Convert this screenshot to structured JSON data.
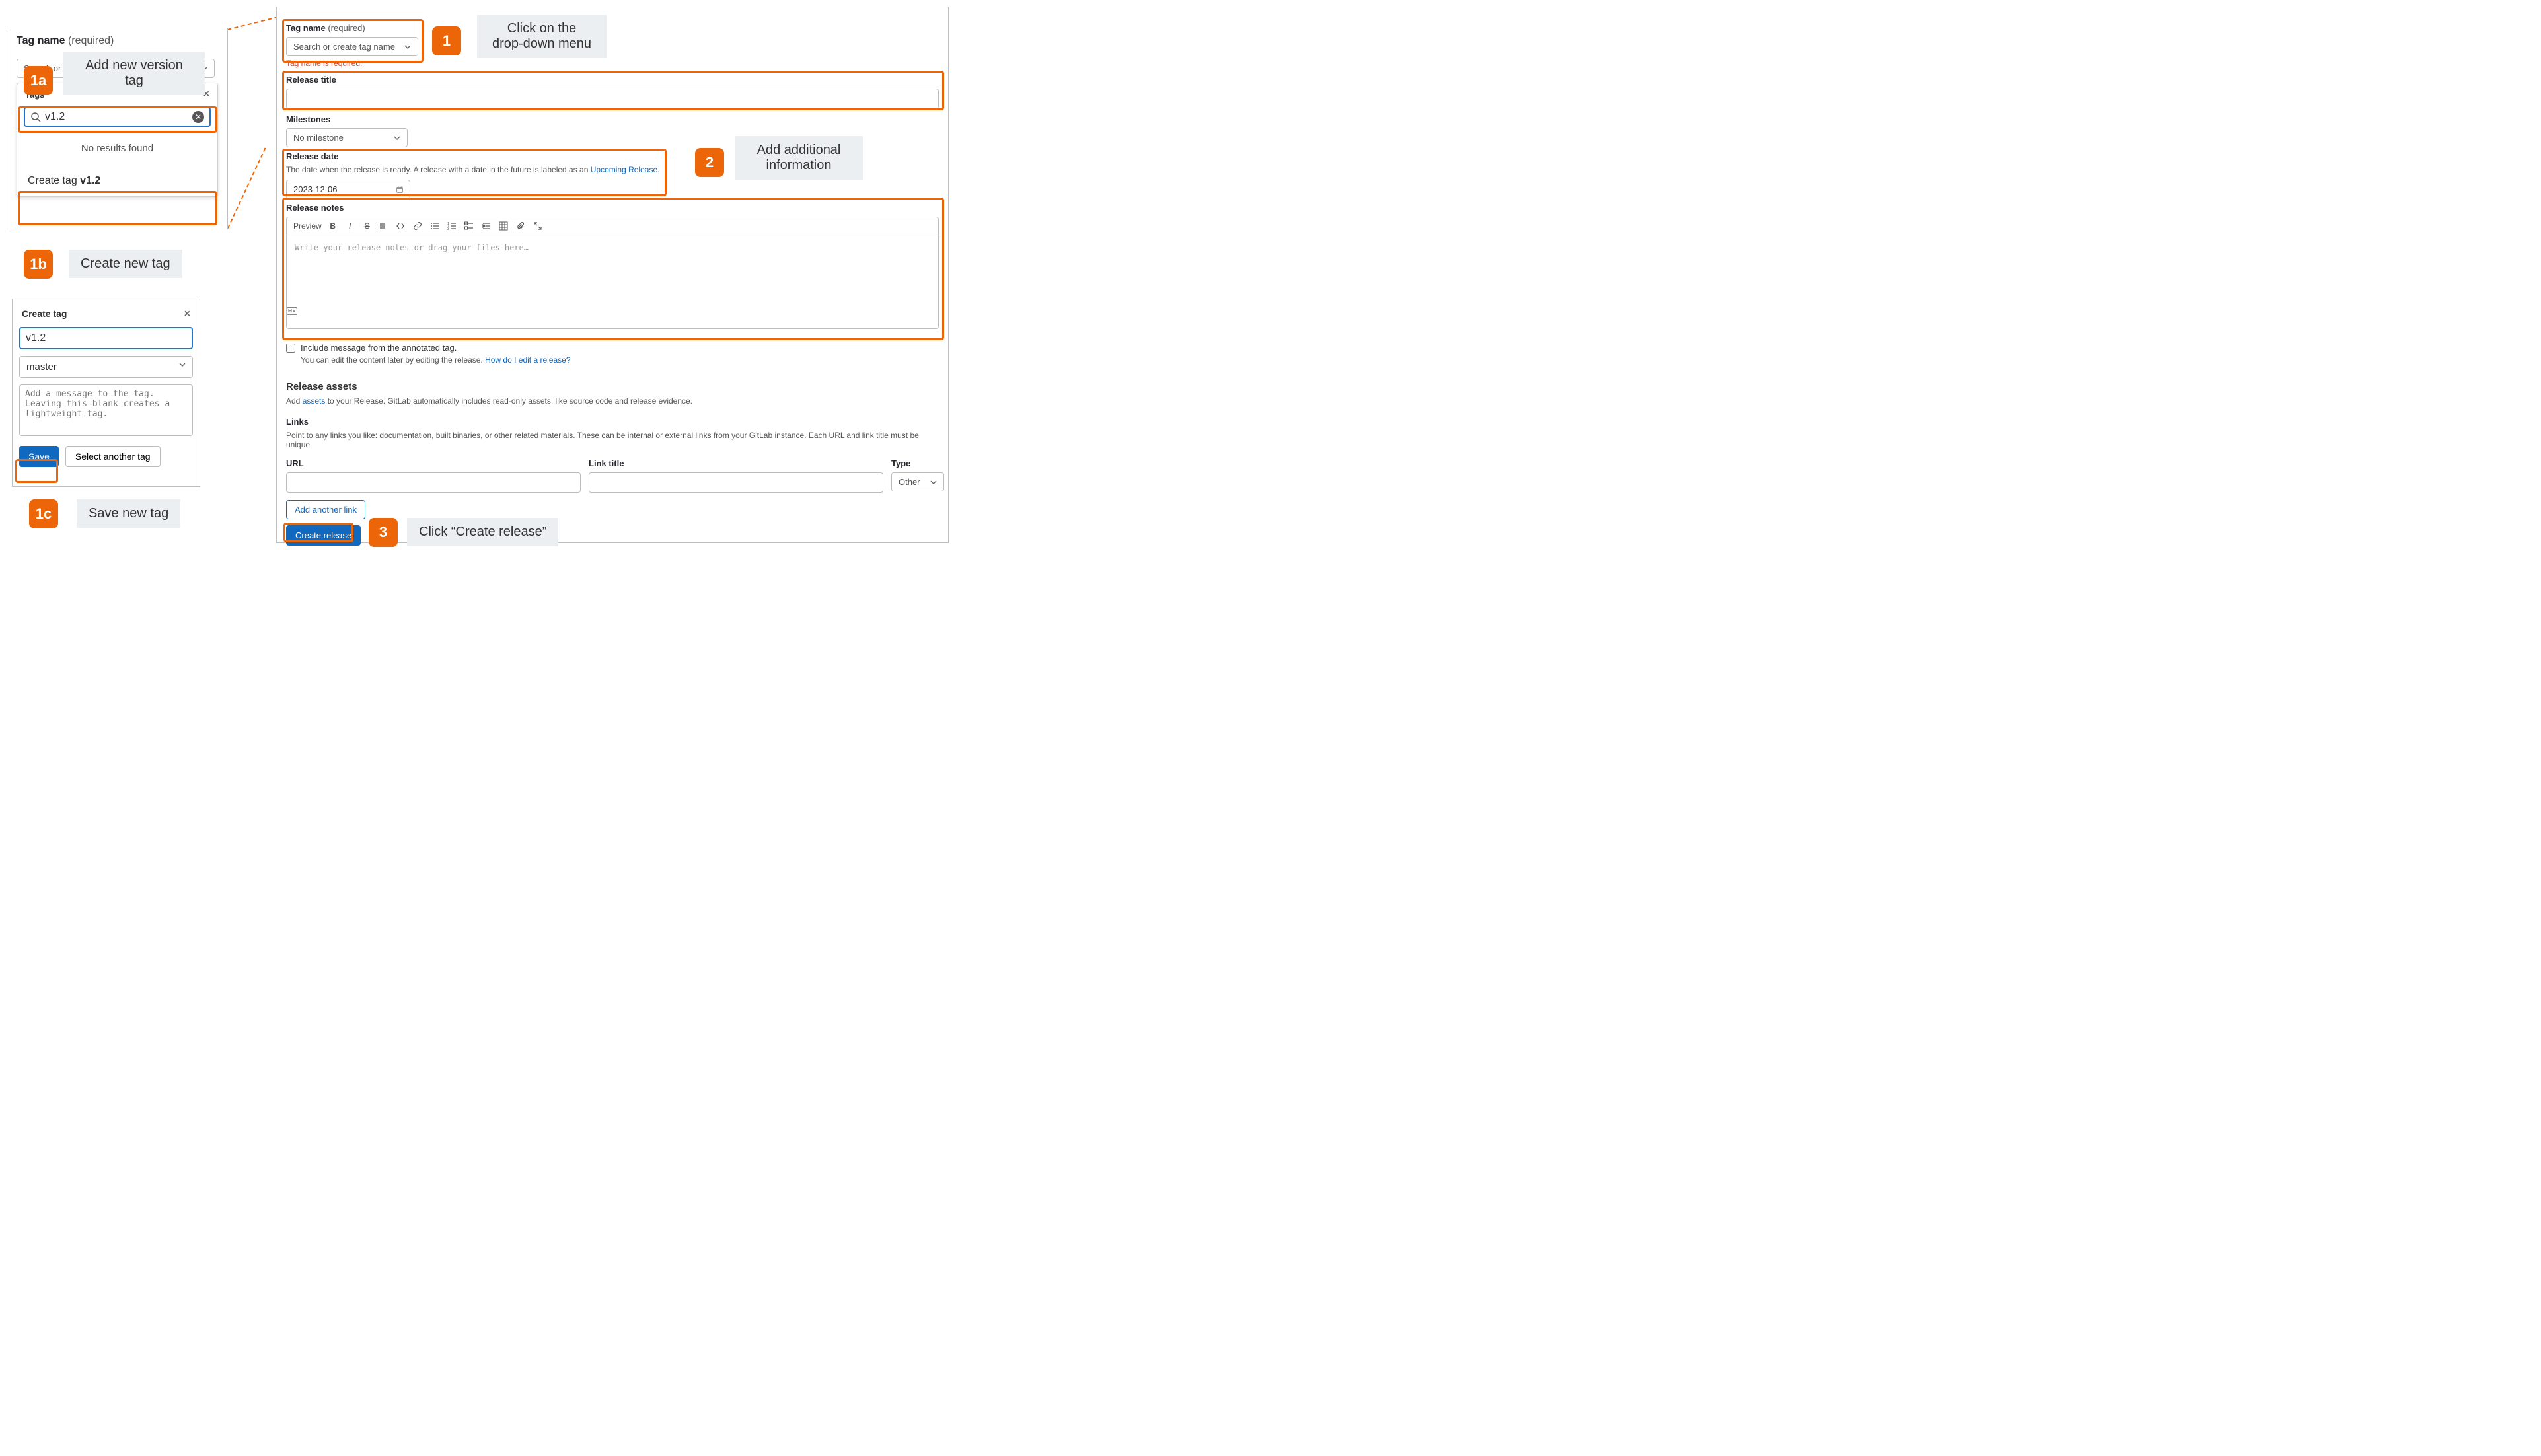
{
  "annotations": {
    "a1": {
      "badge": "1",
      "hint": "Click on the\ndrop-down menu"
    },
    "a1a": {
      "badge": "1a",
      "hint": "Add new version\ntag"
    },
    "a1b": {
      "badge": "1b",
      "hint": "Create new tag"
    },
    "a1c": {
      "badge": "1c",
      "hint": "Save new tag"
    },
    "a2": {
      "badge": "2",
      "hint": "Add additional\ninformation"
    },
    "a3": {
      "badge": "3",
      "hint": "Click “Create release”"
    }
  },
  "form": {
    "tag_name_label": "Tag name",
    "tag_name_required": "(required)",
    "tag_name_select": "Search or create tag name",
    "tag_name_error": "Tag name is required.",
    "release_title_label": "Release title",
    "release_title_value": "",
    "milestones_label": "Milestones",
    "milestones_select": "No milestone",
    "release_date_label": "Release date",
    "release_date_help_pre": "The date when the release is ready. A release with a date in the future is labeled as an ",
    "release_date_help_link": "Upcoming Release",
    "release_date_value": "2023-12-06",
    "notes_label": "Release notes",
    "notes_preview": "Preview",
    "notes_placeholder": "Write your release notes or drag your files here…",
    "include_msg_label": "Include message from the annotated tag.",
    "edit_later_pre": "You can edit the content later by editing the release. ",
    "edit_later_link": "How do I edit a release?",
    "assets_heading": "Release assets",
    "assets_pre": "Add ",
    "assets_link": "assets",
    "assets_post": " to your Release. GitLab automatically includes read-only assets, like source code and release evidence.",
    "links_heading": "Links",
    "links_help": "Point to any links you like: documentation, built binaries, or other related materials. These can be internal or external links from your GitLab instance. Each URL and link title must be unique.",
    "links": {
      "url_label": "URL",
      "url_value": "",
      "title_label": "Link title",
      "title_value": "",
      "type_label": "Type",
      "type_value": "Other"
    },
    "add_link_btn": "Add another link",
    "create_btn": "Create release"
  },
  "tag_popover": {
    "panel_label": "Tag name",
    "panel_required": "(required)",
    "panel_select": "Search or",
    "head": "Tags",
    "search_value": "v1.2",
    "no_results": "No results found",
    "create_prefix": "Create tag ",
    "create_value": "v1.2"
  },
  "create_tag": {
    "head": "Create tag",
    "name_value": "v1.2",
    "branch_value": "master",
    "msg_placeholder": "Add a message to the tag. Leaving this blank creates a lightweight tag.",
    "save_btn": "Save",
    "select_another_btn": "Select another tag"
  }
}
